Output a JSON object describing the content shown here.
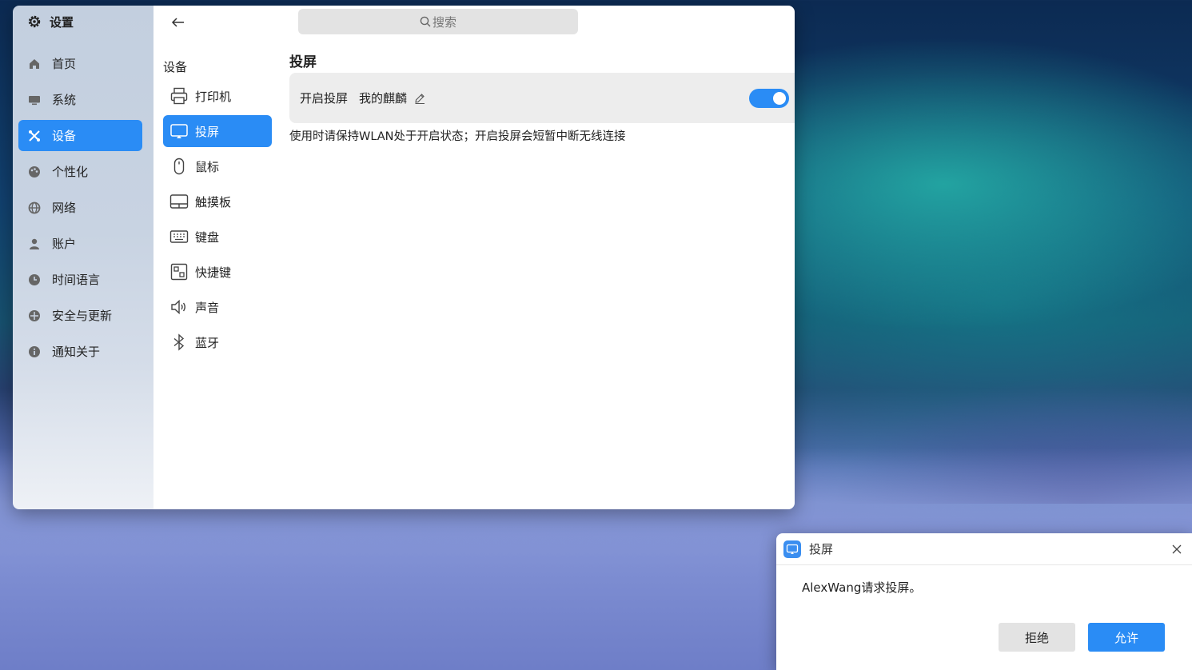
{
  "app": {
    "title": "设置"
  },
  "sidebar": {
    "items": [
      {
        "label": "首页",
        "icon": "home-icon"
      },
      {
        "label": "系统",
        "icon": "monitor-icon"
      },
      {
        "label": "设备",
        "icon": "devices-icon",
        "active": true
      },
      {
        "label": "个性化",
        "icon": "palette-icon"
      },
      {
        "label": "网络",
        "icon": "network-icon"
      },
      {
        "label": "账户",
        "icon": "user-icon"
      },
      {
        "label": "时间语言",
        "icon": "clock-icon"
      },
      {
        "label": "安全与更新",
        "icon": "shield-icon"
      },
      {
        "label": "通知关于",
        "icon": "info-icon"
      }
    ]
  },
  "search": {
    "placeholder": "搜索"
  },
  "subnav": {
    "heading": "设备",
    "items": [
      {
        "label": "打印机",
        "icon": "printer-icon"
      },
      {
        "label": "投屏",
        "icon": "cast-icon",
        "active": true
      },
      {
        "label": "鼠标",
        "icon": "mouse-icon"
      },
      {
        "label": "触摸板",
        "icon": "touchpad-icon"
      },
      {
        "label": "键盘",
        "icon": "keyboard-icon"
      },
      {
        "label": "快捷键",
        "icon": "shortcut-icon"
      },
      {
        "label": "声音",
        "icon": "speaker-icon"
      },
      {
        "label": "蓝牙",
        "icon": "bluetooth-icon"
      }
    ]
  },
  "content": {
    "title": "投屏",
    "cast_label": "开启投屏",
    "device_name": "我的麒麟",
    "cast_enabled": true,
    "hint": "使用时请保持WLAN处于开启状态；开启投屏会短暂中断无线连接"
  },
  "dialog": {
    "title": "投屏",
    "message": "AlexWang请求投屏。",
    "reject_label": "拒绝",
    "allow_label": "允许"
  },
  "colors": {
    "accent": "#2a8cf5"
  }
}
